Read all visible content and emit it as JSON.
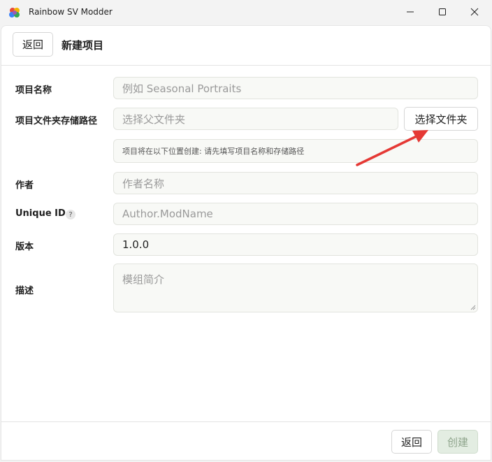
{
  "window": {
    "title": "Rainbow SV Modder",
    "icons": {
      "app": "rainbow-palette-icon",
      "minimize": "minimize-icon",
      "maximize": "maximize-icon",
      "close": "close-icon"
    }
  },
  "header": {
    "back_label": "返回",
    "title": "新建项目"
  },
  "form": {
    "name": {
      "label": "项目名称",
      "placeholder": "例如 Seasonal Portraits"
    },
    "path": {
      "label": "项目文件夹存储路径",
      "placeholder": "选择父文件夹",
      "pick_label": "选择文件夹",
      "hint": "项目将在以下位置创建: 请先填写项目名称和存储路径"
    },
    "author": {
      "label": "作者",
      "placeholder": "作者名称"
    },
    "unique_id": {
      "label": "Unique ID",
      "help": "?",
      "placeholder": "Author.ModName"
    },
    "version": {
      "label": "版本",
      "value": "1.0.0"
    },
    "description": {
      "label": "描述",
      "placeholder": "模组简介"
    }
  },
  "footer": {
    "back_label": "返回",
    "create_label": "创建"
  },
  "colors": {
    "accent_disabled": "#e3ede2",
    "annotation_arrow": "#e53935"
  }
}
